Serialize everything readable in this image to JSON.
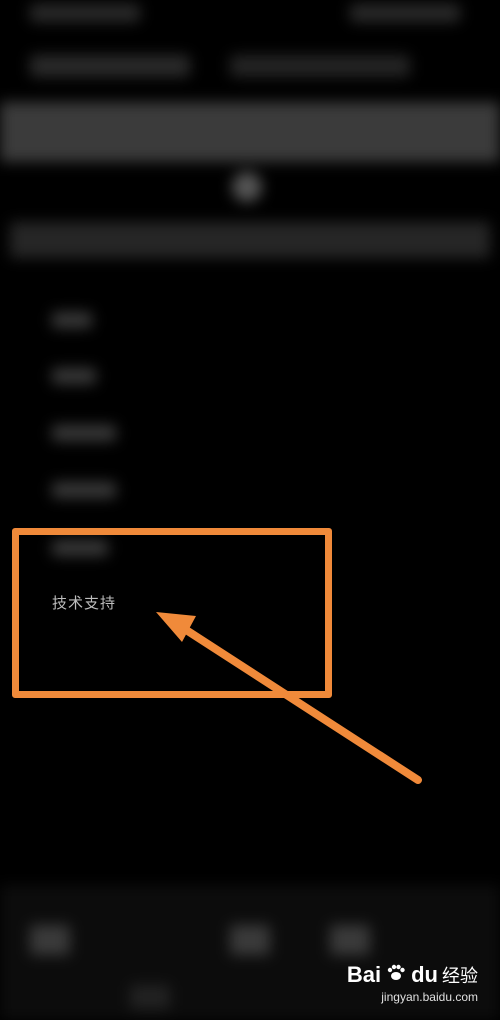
{
  "menu": {
    "tech_support_label": "技术支持"
  },
  "annotation": {
    "highlight_color": "#f08a3a",
    "arrow_color": "#f08a3a"
  },
  "watermark": {
    "brand": "Bai",
    "brand_suffix": "du",
    "text": "经验",
    "url": "jingyan.baidu.com",
    "icon": "paw-icon"
  }
}
